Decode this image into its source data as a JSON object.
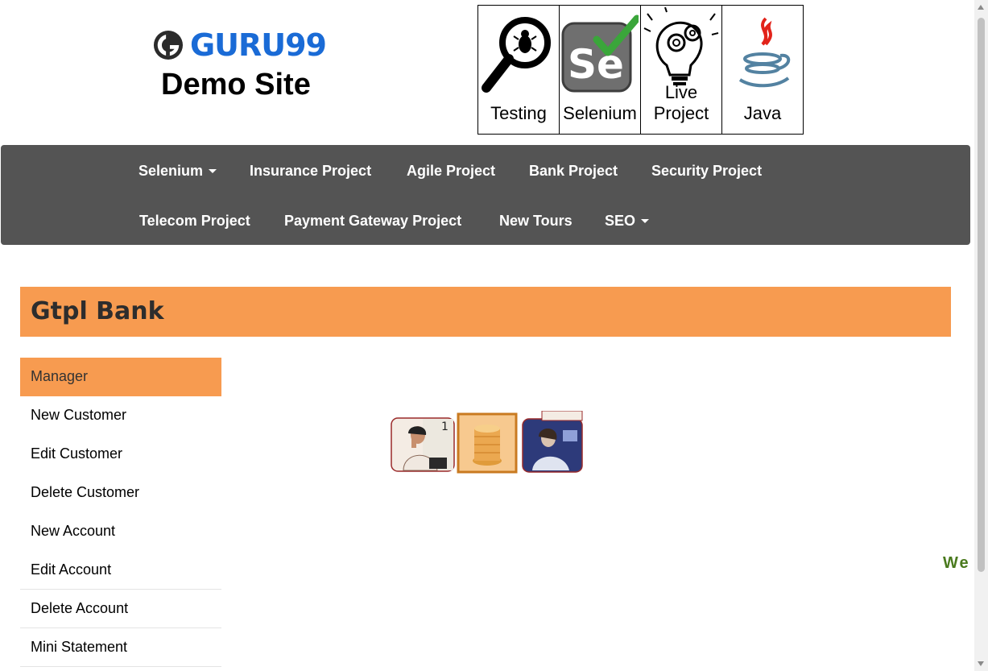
{
  "header": {
    "brand_name": "GURU99",
    "brand_sub": "Demo Site",
    "tiles": [
      {
        "label": "Testing",
        "icon": "magnifier-bug-icon"
      },
      {
        "label": "Selenium",
        "icon": "selenium-logo-icon"
      },
      {
        "label": "Live Project",
        "icon": "lightbulb-gears-icon"
      },
      {
        "label": "Java",
        "icon": "java-logo-icon"
      }
    ]
  },
  "nav": {
    "items": [
      {
        "label": "Selenium",
        "dropdown": true
      },
      {
        "label": "Insurance Project"
      },
      {
        "label": "Agile Project"
      },
      {
        "label": "Bank Project"
      },
      {
        "label": "Security Project"
      },
      {
        "label": "Telecom Project"
      },
      {
        "label": "Payment Gateway Project"
      },
      {
        "label": "New Tours"
      },
      {
        "label": "SEO",
        "dropdown": true
      }
    ]
  },
  "bank_title": "Gtpl Bank",
  "menu": {
    "items": [
      {
        "label": "Manager"
      },
      {
        "label": "New Customer"
      },
      {
        "label": "Edit Customer"
      },
      {
        "label": "Delete Customer"
      },
      {
        "label": "New Account"
      },
      {
        "label": "Edit Account"
      },
      {
        "label": "Delete Account"
      },
      {
        "label": "Mini Statement"
      }
    ]
  },
  "welcome_text": "We",
  "colors": {
    "accent": "#f79b50",
    "nav_bg": "#545454",
    "brand_blue": "#1a6bd6",
    "welcome_green": "#4a7a1e"
  }
}
